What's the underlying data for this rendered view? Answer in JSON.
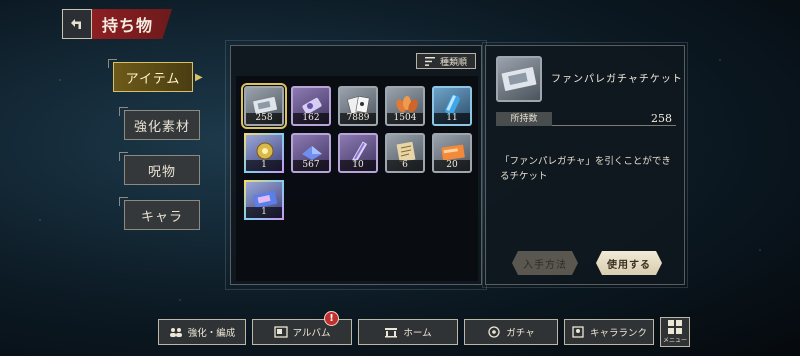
{
  "header": {
    "title": "持ち物"
  },
  "tabs": [
    {
      "label": "アイテム",
      "active": true
    },
    {
      "label": "強化素材",
      "active": false
    },
    {
      "label": "呪物",
      "active": false
    },
    {
      "label": "キャラ",
      "active": false
    }
  ],
  "sort": {
    "label": "種類順"
  },
  "items": [
    {
      "qty": "258",
      "rarity": "gray",
      "icon": "ticket-icon",
      "selected": true
    },
    {
      "qty": "162",
      "rarity": "purple",
      "icon": "potion-icon"
    },
    {
      "qty": "7889",
      "rarity": "gray",
      "icon": "cards-icon"
    },
    {
      "qty": "1504",
      "rarity": "gray",
      "icon": "leaves-icon"
    },
    {
      "qty": "11",
      "rarity": "blue",
      "icon": "vial-icon"
    },
    {
      "qty": "1",
      "rarity": "rainbow",
      "icon": "emblem-icon"
    },
    {
      "qty": "567",
      "rarity": "purple",
      "icon": "crystal-icon"
    },
    {
      "qty": "10",
      "rarity": "purple",
      "icon": "blade-icon"
    },
    {
      "qty": "6",
      "rarity": "gray",
      "icon": "scroll-icon"
    },
    {
      "qty": "20",
      "rarity": "gray",
      "icon": "card-icon"
    },
    {
      "qty": "1",
      "rarity": "rainbow",
      "icon": "special-ticket-icon"
    }
  ],
  "detail": {
    "name": "ファンパレガチャチケット",
    "owned_label": "所持数",
    "owned_value": "258",
    "description": "「ファンパレガチャ」を引くことができるチケット",
    "acquire_label": "入手方法",
    "use_label": "使用する"
  },
  "nav": {
    "enhance": "強化・編成",
    "album": "アルバム",
    "album_badge": "!",
    "home": "ホーム",
    "gacha": "ガチャ",
    "chara_rank": "キャラランク",
    "menu": "メニュー"
  },
  "colors": {
    "accent_gold": "#d9c067",
    "title_red": "#8c1f22",
    "badge_red": "#c0302f"
  }
}
